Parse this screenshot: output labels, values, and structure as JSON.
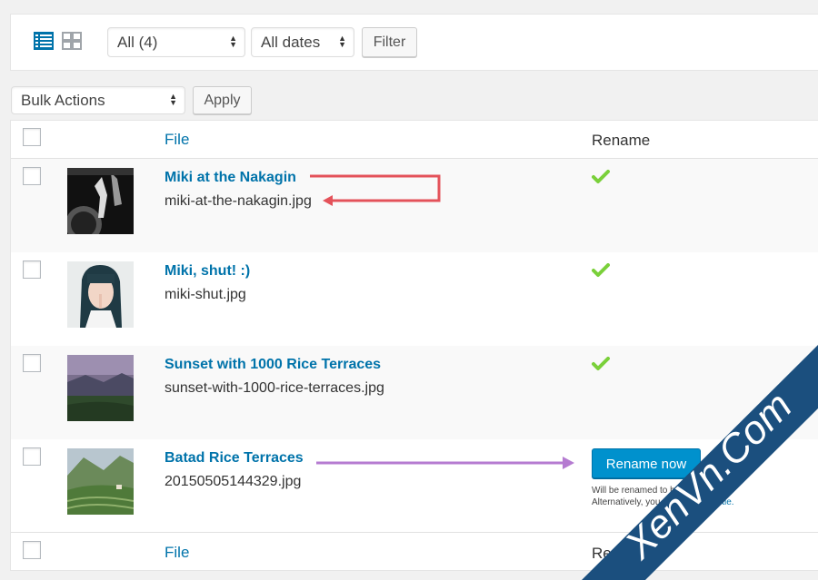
{
  "toolbar": {
    "type_filter": "All (4)",
    "date_filter": "All dates",
    "filter_label": "Filter"
  },
  "bulk": {
    "action": "Bulk Actions",
    "apply_label": "Apply"
  },
  "table": {
    "columns": {
      "file": "File",
      "rename": "Rename"
    },
    "rows": [
      {
        "title": "Miki at the Nakagin",
        "filename": "miki-at-the-nakagin.jpg",
        "status": "check-icon"
      },
      {
        "title": "Miki, shut! :)",
        "filename": "miki-shut.jpg",
        "status": "check-icon"
      },
      {
        "title": "Sunset with 1000 Rice Terraces",
        "filename": "sunset-with-1000-rice-terraces.jpg",
        "status": "check-icon"
      },
      {
        "title": "Batad Rice Terraces",
        "filename": "20150505144329.jpg",
        "status": "rename-button",
        "rename_label": "Rename now",
        "note_line1": "Will be renamed to b",
        "note_line1_end": "ces.",
        "note_line2": "Alternatively, you",
        "note_link": "title."
      }
    ]
  },
  "watermark": "XenVn.Com",
  "colors": {
    "accent": "#0073aa",
    "button_primary": "#0091cd",
    "check": "#7ad03a",
    "arrow_red": "#e4525a",
    "arrow_purple": "#b57bd1",
    "watermark_band": "#1b4f7e"
  }
}
